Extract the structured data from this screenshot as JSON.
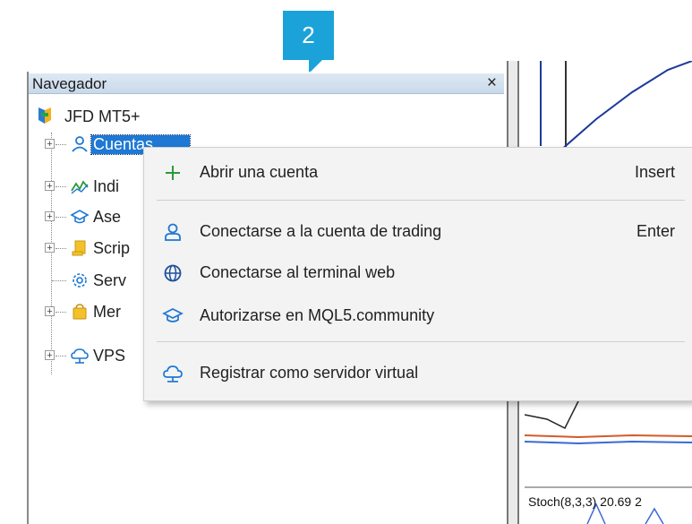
{
  "badge": {
    "number": "2"
  },
  "navigator": {
    "title": "Navegador",
    "close": "×",
    "root": {
      "label": "JFD MT5+"
    },
    "items": [
      {
        "label": "Cuentas",
        "icon": "accounts-icon",
        "expander": "+"
      },
      {
        "label": "Indi",
        "icon": "indicators-icon",
        "expander": "+"
      },
      {
        "label": "Ase",
        "icon": "advisors-icon",
        "expander": "+"
      },
      {
        "label": "Scrip",
        "icon": "scripts-icon",
        "expander": "+"
      },
      {
        "label": "Serv",
        "icon": "services-icon",
        "expander": ""
      },
      {
        "label": "Mer",
        "icon": "market-icon",
        "expander": "+"
      },
      {
        "label": "VPS",
        "icon": "vps-icon",
        "expander": "+"
      }
    ]
  },
  "context_menu": {
    "items": [
      {
        "label": "Abrir una cuenta",
        "shortcut": "Insert",
        "icon": "plus-icon"
      },
      {
        "label": "Conectarse a la cuenta de trading",
        "shortcut": "Enter",
        "icon": "user-icon"
      },
      {
        "label": "Conectarse al terminal web",
        "shortcut": "",
        "icon": "globe-icon"
      },
      {
        "label": "Autorizarse en MQL5.community",
        "shortcut": "",
        "icon": "graduation-cap-icon"
      },
      {
        "label": "Registrar como servidor virtual",
        "shortcut": "",
        "icon": "cloud-icon"
      }
    ]
  },
  "chart": {
    "indicator_label": "Stoch(8,3,3) 20.69 2"
  },
  "colors": {
    "selection": "#1e78d4",
    "badge": "#1ba3d9",
    "accent_icons": "#1e78d4"
  }
}
